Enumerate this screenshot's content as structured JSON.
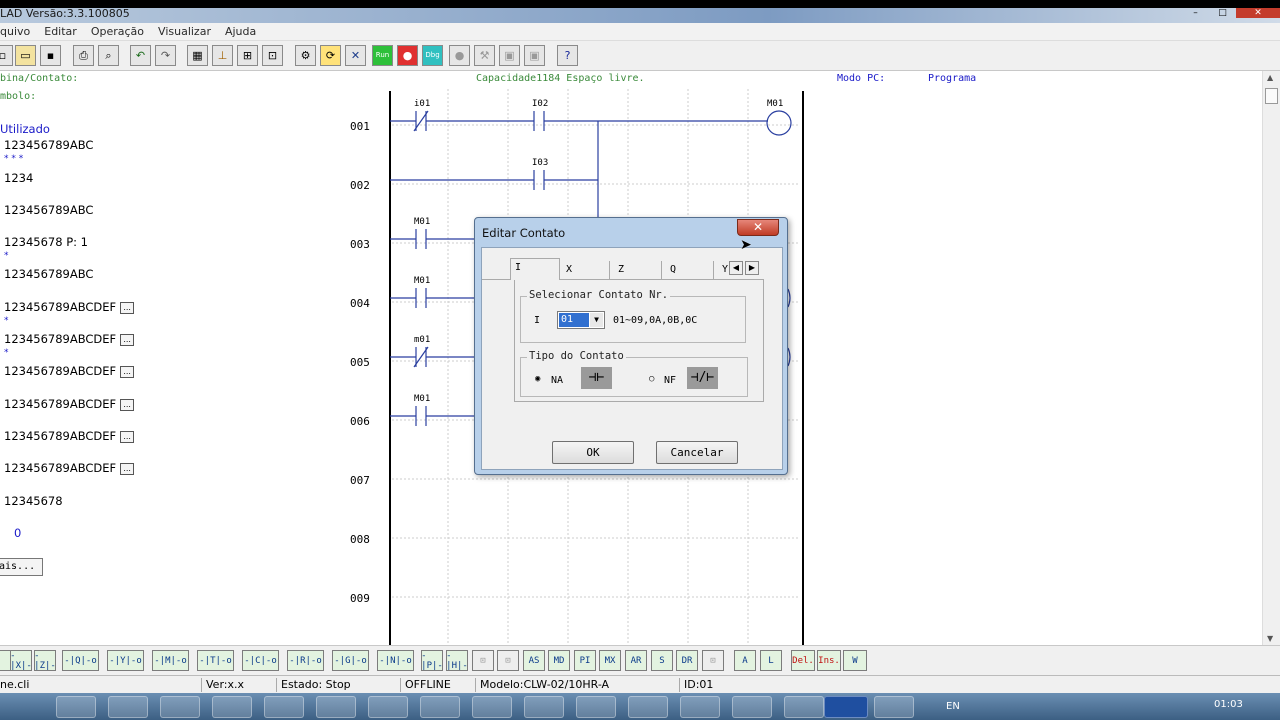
{
  "window": {
    "title": "LAD Versão:3.3.100805"
  },
  "menu": [
    "quivo",
    "Editar",
    "Operação",
    "Visualizar",
    "Ajuda"
  ],
  "infobar": {
    "coil_label": "bina/Contato:",
    "capacity": "Capacidade1184 Espaço livre.",
    "mode_label": "Modo PC:",
    "mode_value": "Programa"
  },
  "left_panel": {
    "symbol_label": "mbolo:",
    "used_label": "Utilizado",
    "rows": [
      {
        "text": "123456789ABC"
      },
      {
        "text": "* * *"
      },
      {
        "text": "1234"
      },
      {
        "text": "123456789ABC"
      },
      {
        "text": "12345678   P: 1"
      },
      {
        "text": "*"
      },
      {
        "text": "123456789ABC"
      },
      {
        "text": "123456789ABCDEF"
      },
      {
        "text": "*"
      },
      {
        "text": "123456789ABCDEF"
      },
      {
        "text": "*"
      },
      {
        "text": "123456789ABCDEF"
      },
      {
        "text": "123456789ABCDEF"
      },
      {
        "text": "123456789ABCDEF"
      },
      {
        "text": "123456789ABCDEF"
      },
      {
        "text": "12345678"
      },
      {
        "text": "0"
      }
    ],
    "more_button": "ais..."
  },
  "ladder": {
    "lines": [
      "001",
      "002",
      "003",
      "004",
      "005",
      "006",
      "007",
      "008",
      "009"
    ],
    "labels": {
      "i01": "i01",
      "I02": "I02",
      "M01_coil": "M01",
      "I03": "I03",
      "M01_a": "M01",
      "M01_b": "M01",
      "m01": "m01",
      "M01_c": "M01"
    }
  },
  "dialog": {
    "title": "Editar Contato",
    "close": "✕",
    "tabs": [
      "I",
      "X",
      "Z",
      "Q",
      "Y"
    ],
    "select_group": "Selecionar Contato Nr.",
    "prefix": "I",
    "selected": "01",
    "range": "01~09,0A,0B,0C",
    "type_group": "Tipo do Contato",
    "na": "NA",
    "nf": "NF",
    "ok": "OK",
    "cancel": "Cancelar"
  },
  "bottom_tools": [
    "-|X|-",
    "-|Z|-",
    "-|Q|-o",
    "-|Y|-o",
    "-|M|-o",
    "-|T|-o",
    "-|C|-o",
    "-|R|-o",
    "-|G|-o",
    "-|N|-o",
    "-|P|-",
    "-|H|-",
    "",
    "",
    "AS",
    "MD",
    "PI",
    "MX",
    "AR",
    "S",
    "DR",
    "",
    "A",
    "L",
    "Del.",
    "Ins.",
    "W"
  ],
  "status": {
    "file": "ne.cli",
    "version": "Ver:x.x",
    "state": "Estado: Stop",
    "connection": "OFFLINE",
    "model": "Modelo:CLW-02/10HR-A",
    "id": "ID:01"
  },
  "taskbar": {
    "lang": "EN",
    "time": "01:03"
  }
}
